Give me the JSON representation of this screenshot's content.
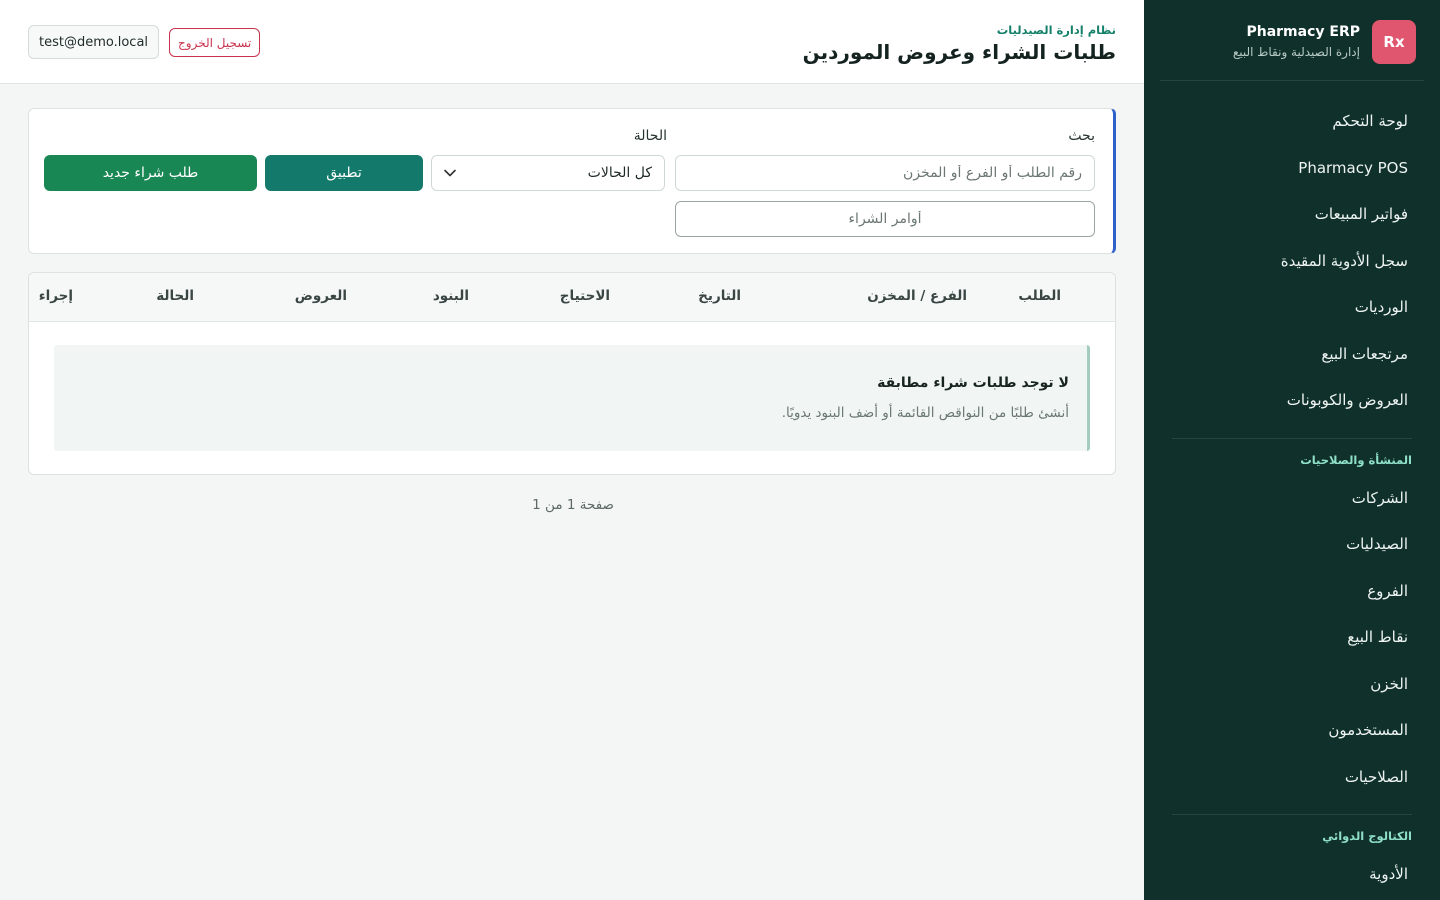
{
  "sidebar": {
    "logo": "Rx",
    "app_name": "Pharmacy ERP",
    "app_subtitle": "إدارة الصيدلية ونقاط البيع",
    "main_items": [
      "لوحة التحكم",
      "Pharmacy POS",
      "فواتير المبيعات",
      "سجل الأدوية المقيدة",
      "الورديات",
      "مرتجعات البيع",
      "العروض والكوبونات"
    ],
    "group_org": {
      "title": "المنشأة والصلاحيات",
      "items": [
        "الشركات",
        "الصيدليات",
        "الفروع",
        "نقاط البيع",
        "الخزن",
        "المستخدمون",
        "الصلاحيات"
      ]
    },
    "group_catalog": {
      "title": "الكتالوج الدوائي",
      "items": [
        "الأدوية"
      ]
    }
  },
  "header": {
    "eyebrow": "نظام إدارة الصيدليات",
    "title": "طلبات الشراء وعروض الموردين",
    "user_email": "test@demo.local",
    "logout_label": "تسجيل الخروج"
  },
  "filters": {
    "search_label": "بحث",
    "search_placeholder": "رقم الطلب أو الفرع أو المخزن",
    "status_label": "الحالة",
    "status_selected": "كل الحالات",
    "apply_label": "تطبيق",
    "new_request_label": "طلب شراء جديد",
    "tag_placeholder": "أوامر الشراء"
  },
  "table": {
    "columns": [
      "الطلب",
      "الفرع / المخزن",
      "التاريخ",
      "الاحتياج",
      "البنود",
      "العروض",
      "الحالة",
      "إجراء"
    ],
    "empty_title": "لا توجد طلبات شراء مطابقة",
    "empty_subtitle": "أنشئ طلبًا من النواقص القائمة أو أضف البنود يدويًا."
  },
  "pagination": {
    "label": "صفحة 1 من 1"
  },
  "colors": {
    "sidebar_bg": "#10302b",
    "primary": "#137a6b",
    "success": "#198754",
    "danger": "#c9334d",
    "logo_bg": "#e0566e",
    "accent_border": "#2f62c9"
  }
}
